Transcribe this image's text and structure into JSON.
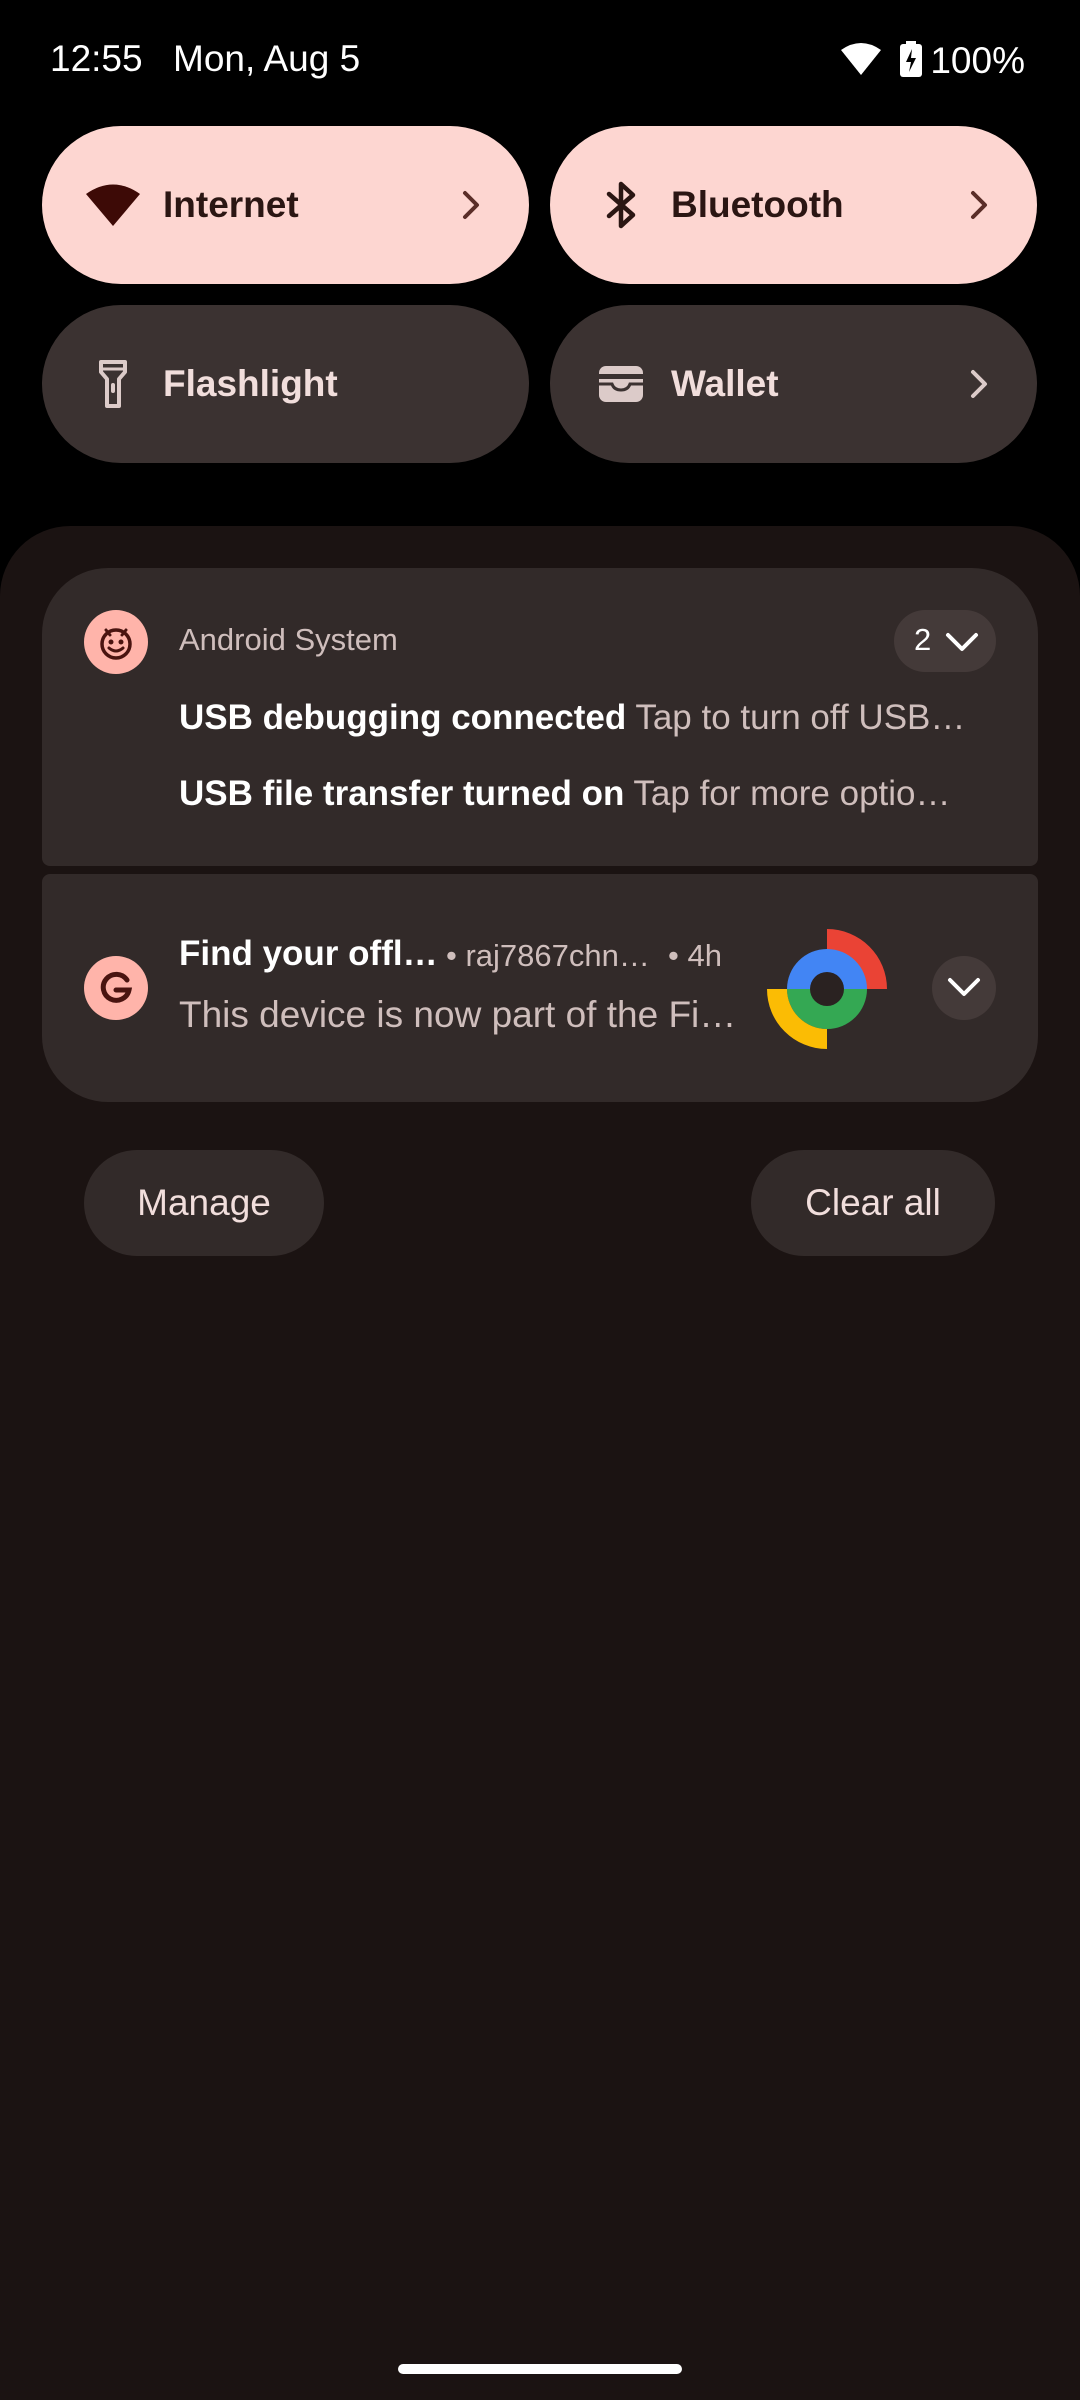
{
  "status_bar": {
    "time": "12:55",
    "date": "Mon, Aug 5",
    "battery_percent": "100%",
    "icons": [
      "wifi-icon",
      "battery-charging-icon"
    ]
  },
  "quick_settings": {
    "tiles": [
      {
        "label": "Internet",
        "icon": "wifi-icon",
        "state": "on",
        "has_chevron": true
      },
      {
        "label": "Bluetooth",
        "icon": "bluetooth-icon",
        "state": "on",
        "has_chevron": true
      },
      {
        "label": "Flashlight",
        "icon": "flashlight-icon",
        "state": "off",
        "has_chevron": false
      },
      {
        "label": "Wallet",
        "icon": "wallet-icon",
        "state": "off",
        "has_chevron": true
      }
    ]
  },
  "notifications": {
    "android_system": {
      "app_name": "Android System",
      "count": "2",
      "items": [
        {
          "title": "USB debugging connected",
          "text": "Tap to turn off USB…"
        },
        {
          "title": "USB file transfer turned on",
          "text": "Tap for more optio…"
        }
      ]
    },
    "find_device": {
      "title": "Find your offl…",
      "account": "• raj7867chn…",
      "time": "• 4h",
      "text": "This device is now part of the Fi…"
    }
  },
  "actions": {
    "manage": "Manage",
    "clear_all": "Clear all"
  },
  "colors": {
    "tile_on": "#fdd6d1",
    "tile_off": "#3b3231",
    "shade": "#1b1312",
    "card": "#322a29",
    "accent_icon": "#ffb4aa"
  }
}
